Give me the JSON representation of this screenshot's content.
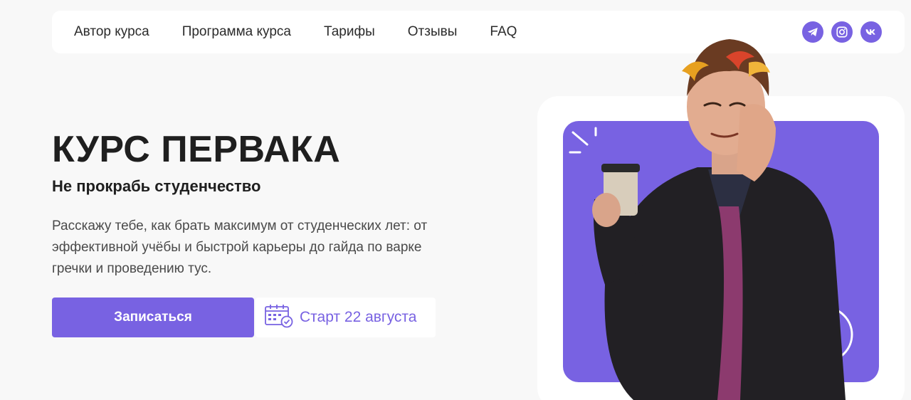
{
  "nav": {
    "links": [
      "Автор курса",
      "Программа курса",
      "Тарифы",
      "Отзывы",
      "FAQ"
    ],
    "socials": [
      "telegram-icon",
      "instagram-icon",
      "vk-icon"
    ]
  },
  "hero": {
    "title": "КУРС ПЕРВАКА",
    "subtitle": "Не прокрабь студенчество",
    "description": "Расскажу тебе, как брать максимум от студенческих лет: от эффективной учёбы и быстрой карьеры до гайда по варке гречки и проведению тус.",
    "cta_label": "Записаться",
    "start_label": "Старт 22 августа"
  },
  "colors": {
    "accent": "#7862e2",
    "background": "#f8f8f8",
    "card": "#ffffff",
    "text": "#1f1f1f"
  }
}
